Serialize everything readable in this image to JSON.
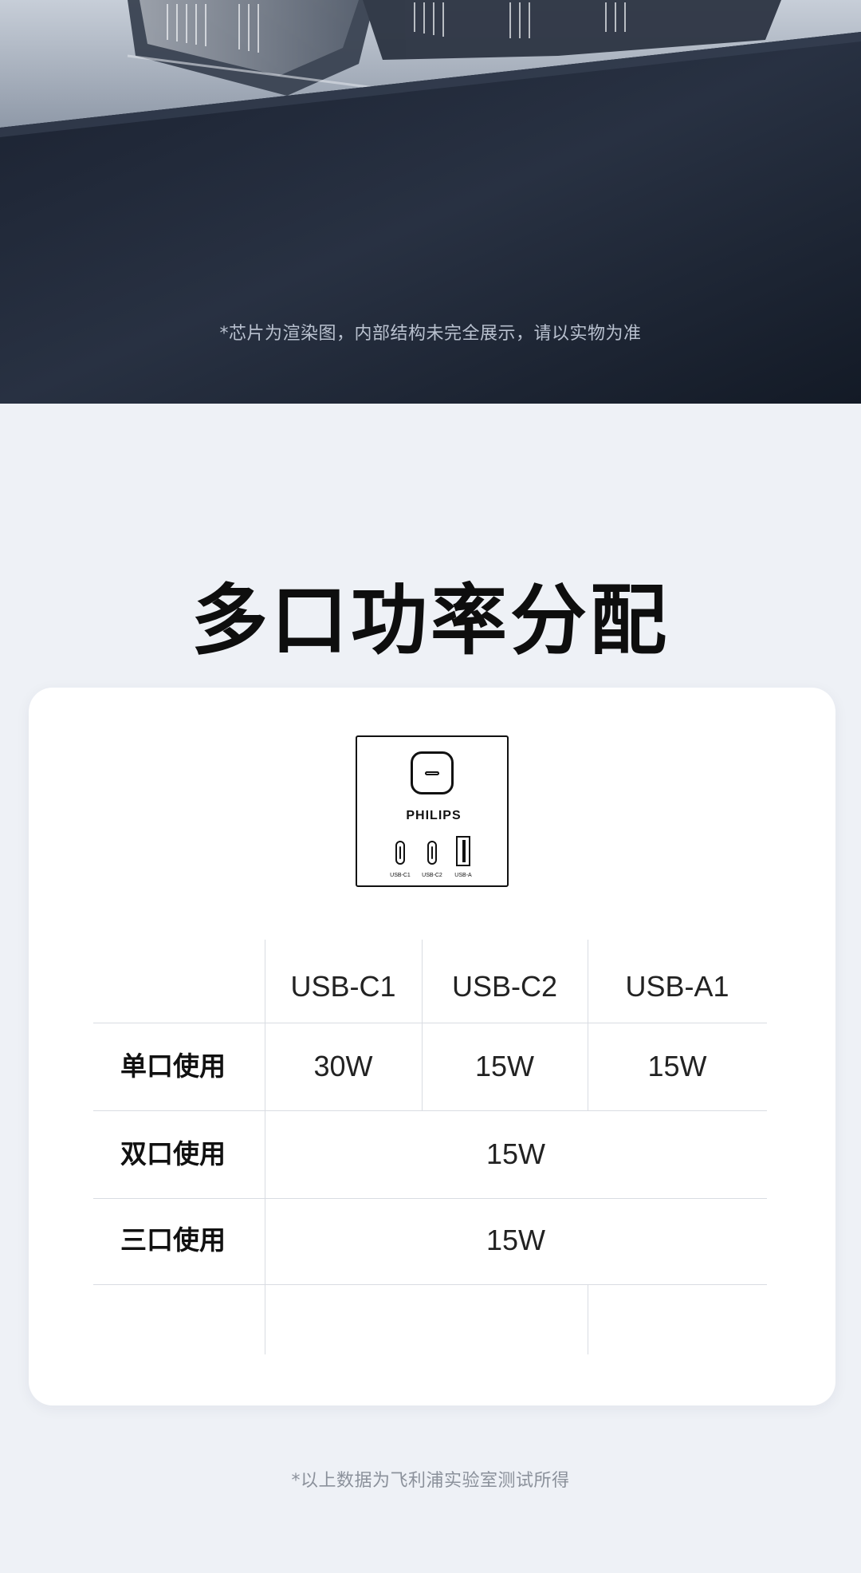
{
  "hero": {
    "note": "*芯片为渲染图，内部结构未完全展示，请以实物为准"
  },
  "title": "多口功率分配",
  "device": {
    "brand": "PHILIPS",
    "ports": [
      "USB-C1",
      "USB-C2",
      "USB-A"
    ]
  },
  "table": {
    "columns": [
      "USB-C1",
      "USB-C2",
      "USB-A1"
    ],
    "rows": [
      {
        "label": "单口使用",
        "values": [
          "30W",
          "15W",
          "15W"
        ]
      },
      {
        "label": "双口使用",
        "values": [
          "15W"
        ]
      },
      {
        "label": "三口使用",
        "values": [
          "15W"
        ]
      }
    ]
  },
  "footnote": "*以上数据为飞利浦实验室测试所得"
}
